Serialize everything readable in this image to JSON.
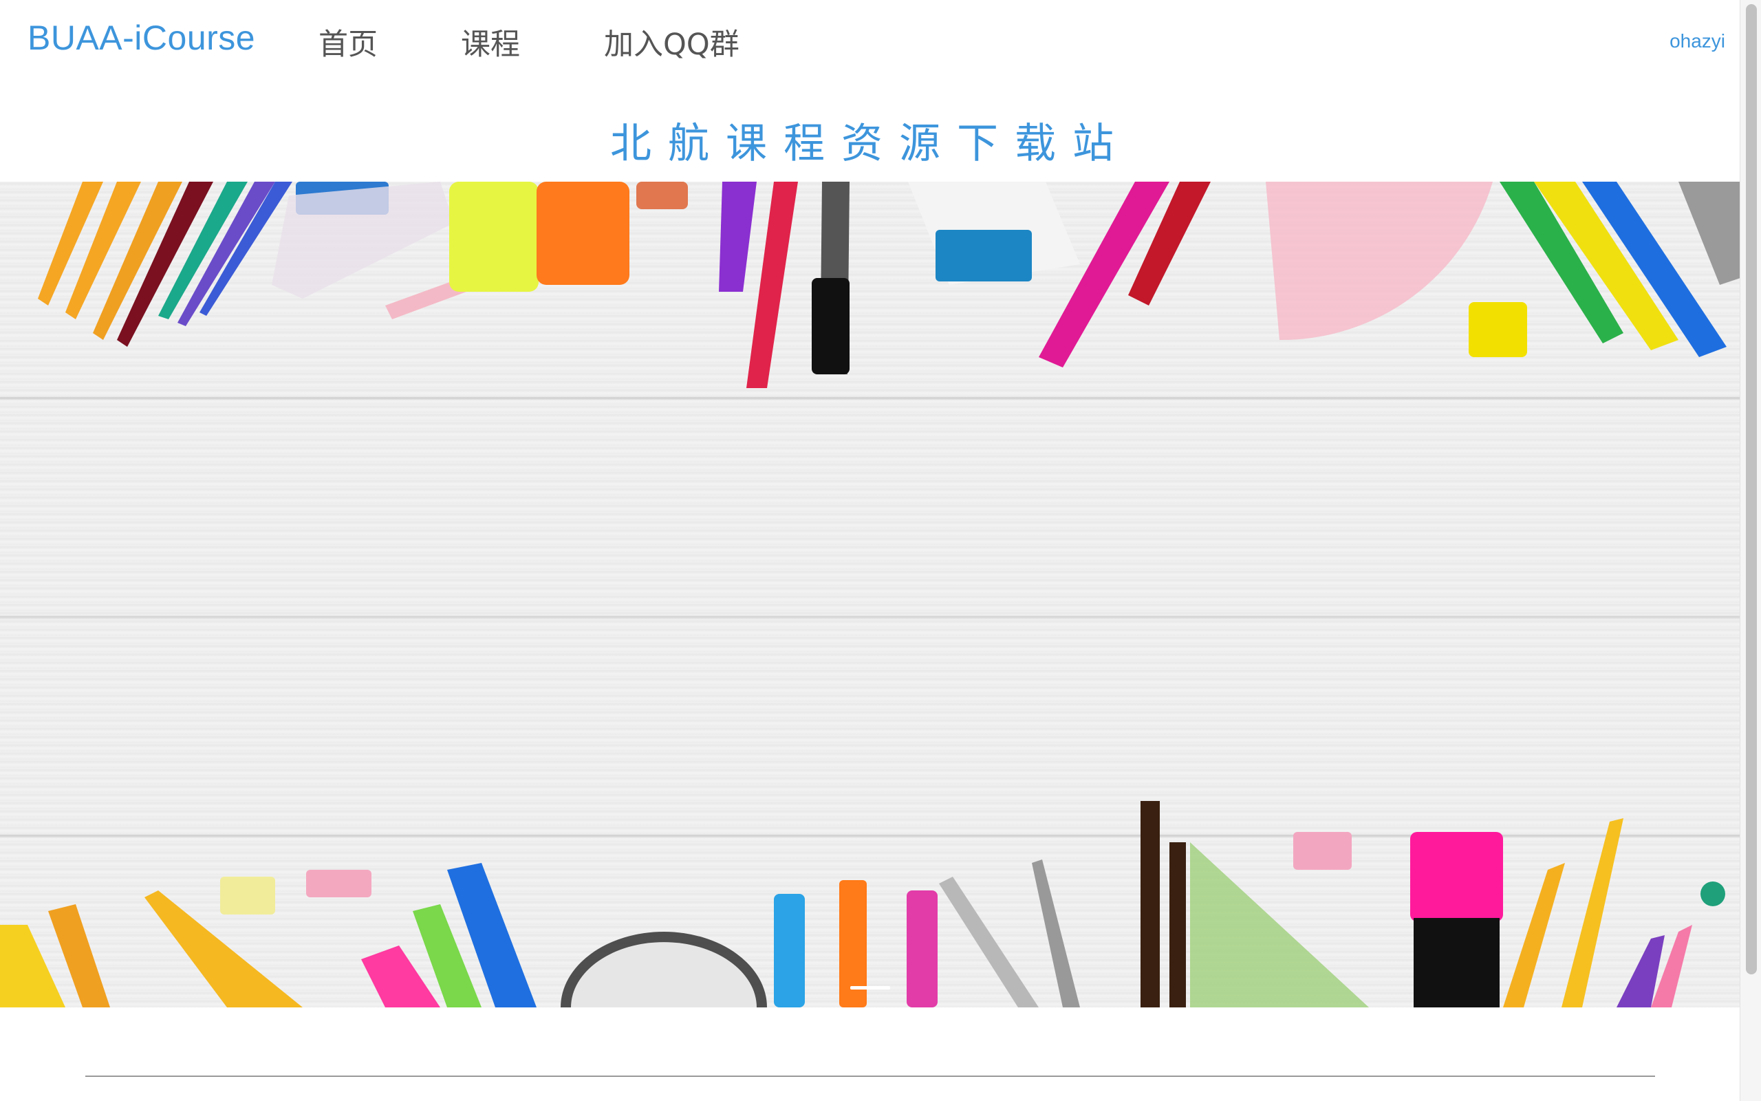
{
  "nav": {
    "brand": "BUAA-iCourse",
    "items": [
      {
        "label": "首页"
      },
      {
        "label": "课程"
      },
      {
        "label": "加入QQ群"
      }
    ],
    "user": "ohazyi"
  },
  "site_title": "北航课程资源下载站",
  "hero": {
    "image_description": "stationery-on-white-wood-banner",
    "slides_visible_indicator": "active"
  },
  "colors": {
    "accent": "#3d95dc",
    "nav_text": "#555555",
    "divider": "#999999"
  }
}
